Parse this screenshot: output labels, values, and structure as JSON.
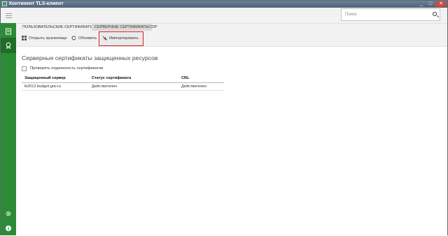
{
  "window": {
    "title": "Континент TLS-клиент",
    "controls": [
      "_",
      "□",
      "✕"
    ]
  },
  "search": {
    "placeholder": "Поиск"
  },
  "tabs": [
    {
      "label": "ПОЛЬЗОВАТЕЛЬСКИЕ СЕРТИФИКАТЫ",
      "active": false
    },
    {
      "label": "СЕРВЕРНЫЕ СЕРТИФИКАТЫ",
      "active": true
    },
    {
      "label": "CDP",
      "active": false
    }
  ],
  "toolbar": {
    "open_store": "Открыть хранилище",
    "refresh": "Обновить",
    "import": "Импортировать"
  },
  "main": {
    "heading": "Серверные сертификаты защищенных ресурсов",
    "verify_checkbox_label": "Проверять подлинность сертификатов",
    "verify_checked": false,
    "columns": [
      "Защищенный сервер",
      "Статус сертификата",
      "CRL"
    ],
    "rows": [
      [
        "lk2012.budget.gov.ru",
        "Действителен",
        "Действителен"
      ]
    ]
  },
  "sidebar": {
    "items": [
      {
        "icon": "certificate-list-icon",
        "active": false
      },
      {
        "icon": "certificate-badge-icon",
        "active": true
      },
      {
        "icon": "settings-icon",
        "active": false
      },
      {
        "icon": "info-icon",
        "active": false
      }
    ]
  },
  "colors": {
    "sidebar_green": "#2c8c35",
    "sidebar_active": "#1f6d27",
    "highlight_red": "#d81e2a"
  }
}
